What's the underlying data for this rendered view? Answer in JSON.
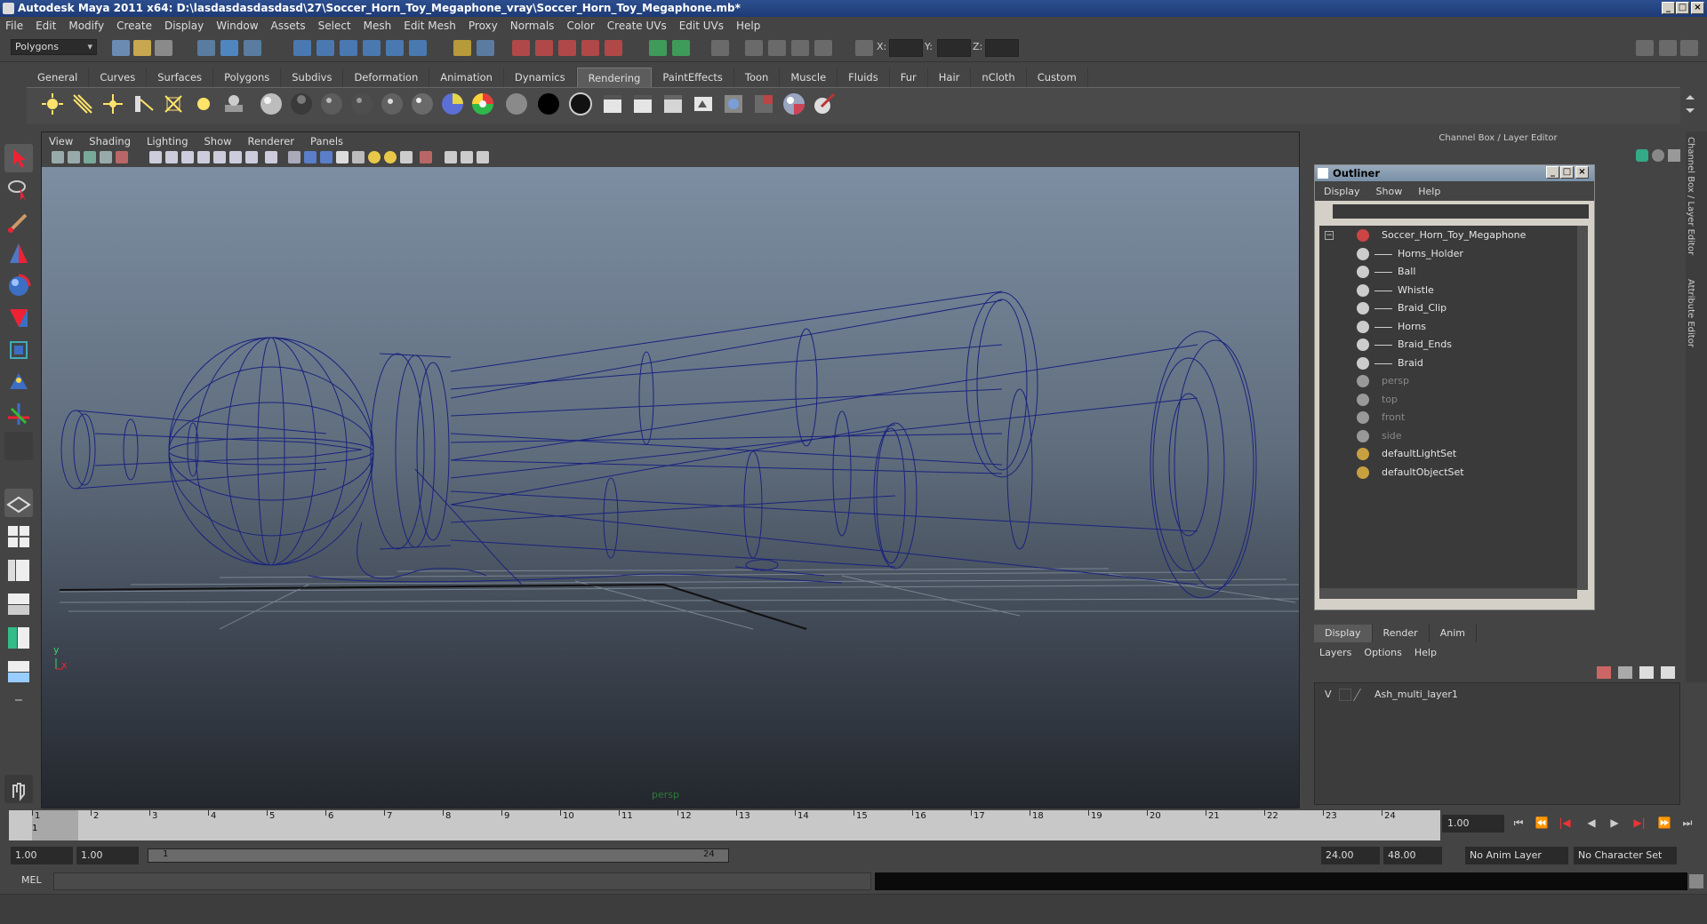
{
  "title": "Autodesk Maya 2011 x64: D:\\lasdasdasdasdasd\\27\\Soccer_Horn_Toy_Megaphone_vray\\Soccer_Horn_Toy_Megaphone.mb*",
  "menubar": [
    "File",
    "Edit",
    "Modify",
    "Create",
    "Display",
    "Window",
    "Assets",
    "Select",
    "Mesh",
    "Edit Mesh",
    "Proxy",
    "Normals",
    "Color",
    "Create UVs",
    "Edit UVs",
    "Help"
  ],
  "status": {
    "mode": "Polygons",
    "x_label": "X:",
    "y_label": "Y:",
    "z_label": "Z:"
  },
  "shelf_tabs": [
    "General",
    "Curves",
    "Surfaces",
    "Polygons",
    "Subdivs",
    "Deformation",
    "Animation",
    "Dynamics",
    "Rendering",
    "PaintEffects",
    "Toon",
    "Muscle",
    "Fluids",
    "Fur",
    "Hair",
    "nCloth",
    "Custom"
  ],
  "active_shelf_tab": "Rendering",
  "viewport": {
    "menu": [
      "View",
      "Shading",
      "Lighting",
      "Show",
      "Renderer",
      "Panels"
    ],
    "camera_label": "persp",
    "axis_y": "y",
    "axis_x": "x",
    "wire_color": "#1a237e"
  },
  "channel_box_title": "Channel Box / Layer Editor",
  "outliner": {
    "title": "Outliner",
    "menu": [
      "Display",
      "Show",
      "Help"
    ],
    "items": [
      {
        "label": "Soccer_Horn_Toy_Megaphone",
        "level": 0,
        "dim": false,
        "icon": "transform-icon"
      },
      {
        "label": "Horns_Holder",
        "level": 1,
        "dim": false,
        "icon": "mesh-icon"
      },
      {
        "label": "Ball",
        "level": 1,
        "dim": false,
        "icon": "mesh-icon"
      },
      {
        "label": "Whistle",
        "level": 1,
        "dim": false,
        "icon": "mesh-icon"
      },
      {
        "label": "Braid_Clip",
        "level": 1,
        "dim": false,
        "icon": "mesh-icon"
      },
      {
        "label": "Horns",
        "level": 1,
        "dim": false,
        "icon": "mesh-icon"
      },
      {
        "label": "Braid_Ends",
        "level": 1,
        "dim": false,
        "icon": "mesh-icon"
      },
      {
        "label": "Braid",
        "level": 1,
        "dim": false,
        "icon": "mesh-icon"
      },
      {
        "label": "persp",
        "level": 0,
        "dim": true,
        "icon": "camera-icon"
      },
      {
        "label": "top",
        "level": 0,
        "dim": true,
        "icon": "camera-icon"
      },
      {
        "label": "front",
        "level": 0,
        "dim": true,
        "icon": "camera-icon"
      },
      {
        "label": "side",
        "level": 0,
        "dim": true,
        "icon": "camera-icon"
      },
      {
        "label": "defaultLightSet",
        "level": 0,
        "dim": false,
        "icon": "set-icon"
      },
      {
        "label": "defaultObjectSet",
        "level": 0,
        "dim": false,
        "icon": "set-icon"
      }
    ]
  },
  "layer_editor": {
    "tabs": [
      "Display",
      "Render",
      "Anim"
    ],
    "active_tab": "Display",
    "menu": [
      "Layers",
      "Options",
      "Help"
    ],
    "layer_visibility": "V",
    "layer_name": "Ash_multi_layer1"
  },
  "side_tabs": [
    "Channel Box / Layer Editor",
    "Attribute Editor"
  ],
  "timeline": {
    "ticks": [
      "1",
      "2",
      "3",
      "4",
      "5",
      "6",
      "7",
      "8",
      "9",
      "10",
      "11",
      "12",
      "13",
      "14",
      "15",
      "16",
      "17",
      "18",
      "19",
      "20",
      "21",
      "22",
      "23",
      "24"
    ],
    "current_frame": "1.00",
    "current_marker": "1"
  },
  "range": {
    "start": "1.00",
    "playback_start": "1.00",
    "slider_start": "1",
    "slider_end": "24",
    "playback_end": "24.00",
    "end": "48.00",
    "anim_layer": "No Anim Layer",
    "character_set": "No Character Set"
  },
  "command_line": {
    "label": "MEL"
  }
}
